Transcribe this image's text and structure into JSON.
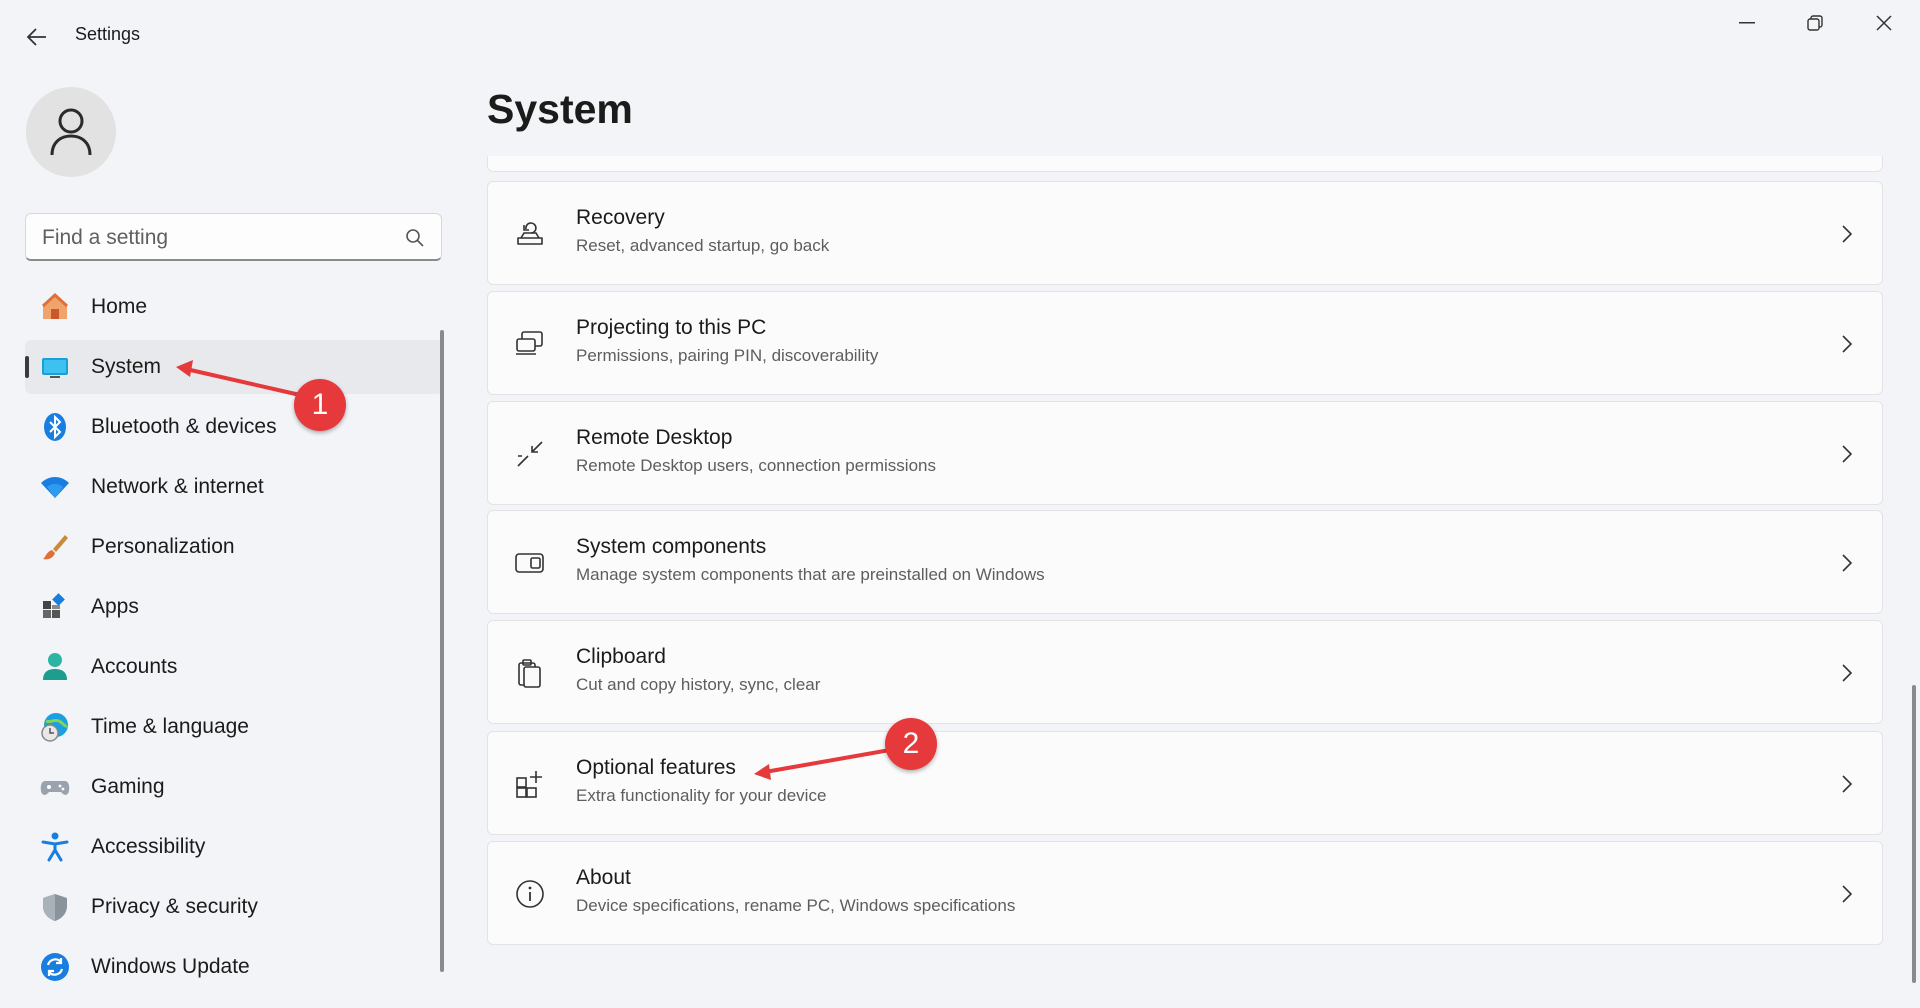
{
  "window": {
    "title": "Settings"
  },
  "search": {
    "placeholder": "Find a setting"
  },
  "sidebar": {
    "items": [
      {
        "label": "Home",
        "icon": "home-icon"
      },
      {
        "label": "System",
        "icon": "system-icon",
        "active": true
      },
      {
        "label": "Bluetooth & devices",
        "icon": "bluetooth-icon"
      },
      {
        "label": "Network & internet",
        "icon": "wifi-icon"
      },
      {
        "label": "Personalization",
        "icon": "brush-icon"
      },
      {
        "label": "Apps",
        "icon": "apps-icon"
      },
      {
        "label": "Accounts",
        "icon": "accounts-icon"
      },
      {
        "label": "Time & language",
        "icon": "globe-clock-icon"
      },
      {
        "label": "Gaming",
        "icon": "gamepad-icon"
      },
      {
        "label": "Accessibility",
        "icon": "accessibility-icon"
      },
      {
        "label": "Privacy & security",
        "icon": "shield-icon"
      },
      {
        "label": "Windows Update",
        "icon": "update-icon"
      }
    ]
  },
  "main": {
    "title": "System",
    "cards": [
      {
        "title": "Recovery",
        "desc": "Reset, advanced startup, go back",
        "icon": "recovery-icon"
      },
      {
        "title": "Projecting to this PC",
        "desc": "Permissions, pairing PIN, discoverability",
        "icon": "projecting-icon"
      },
      {
        "title": "Remote Desktop",
        "desc": "Remote Desktop users, connection permissions",
        "icon": "remote-desktop-icon"
      },
      {
        "title": "System components",
        "desc": "Manage system components that are preinstalled on Windows",
        "icon": "system-components-icon"
      },
      {
        "title": "Clipboard",
        "desc": "Cut and copy history, sync, clear",
        "icon": "clipboard-icon"
      },
      {
        "title": "Optional features",
        "desc": "Extra functionality for your device",
        "icon": "optional-features-icon"
      },
      {
        "title": "About",
        "desc": "Device specifications, rename PC, Windows specifications",
        "icon": "info-icon"
      }
    ]
  },
  "annotations": [
    {
      "number": "1",
      "color": "#e5393b"
    },
    {
      "number": "2",
      "color": "#e5393b"
    }
  ]
}
